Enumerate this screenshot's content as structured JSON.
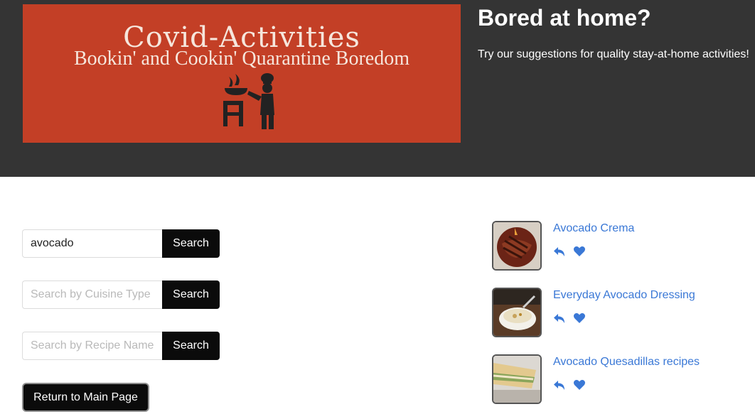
{
  "banner": {
    "title": "Covid-Activities",
    "subtitle": "Bookin' and Cookin' Quarantine Boredom",
    "background": "#c33f26",
    "icon": "chef-cooking-icon"
  },
  "hero": {
    "headline": "Bored at home?",
    "tagline": "Try our suggestions for quality stay-at-home activities!"
  },
  "search_forms": [
    {
      "value": "avocado",
      "placeholder": "",
      "button_label": "Search"
    },
    {
      "value": "",
      "placeholder": "Search by Cuisine Type",
      "button_label": "Search"
    },
    {
      "value": "",
      "placeholder": "Search by Recipe Name",
      "button_label": "Search"
    }
  ],
  "return_button_label": "Return to Main Page",
  "results": [
    {
      "title": "Avocado Crema",
      "thumb": "grilled-steak-photo",
      "icons": [
        "reply-icon",
        "heart-icon"
      ]
    },
    {
      "title": "Everyday Avocado Dressing",
      "thumb": "dressing-bowl-photo",
      "icons": [
        "reply-icon",
        "heart-icon"
      ]
    },
    {
      "title": "Avocado Quesadillas recipes",
      "thumb": "quesadilla-photo",
      "icons": [
        "reply-icon",
        "heart-icon"
      ]
    }
  ],
  "colors": {
    "hero_bg": "#343434",
    "button_bg": "#0b0b0b",
    "link": "#3a78d6"
  }
}
